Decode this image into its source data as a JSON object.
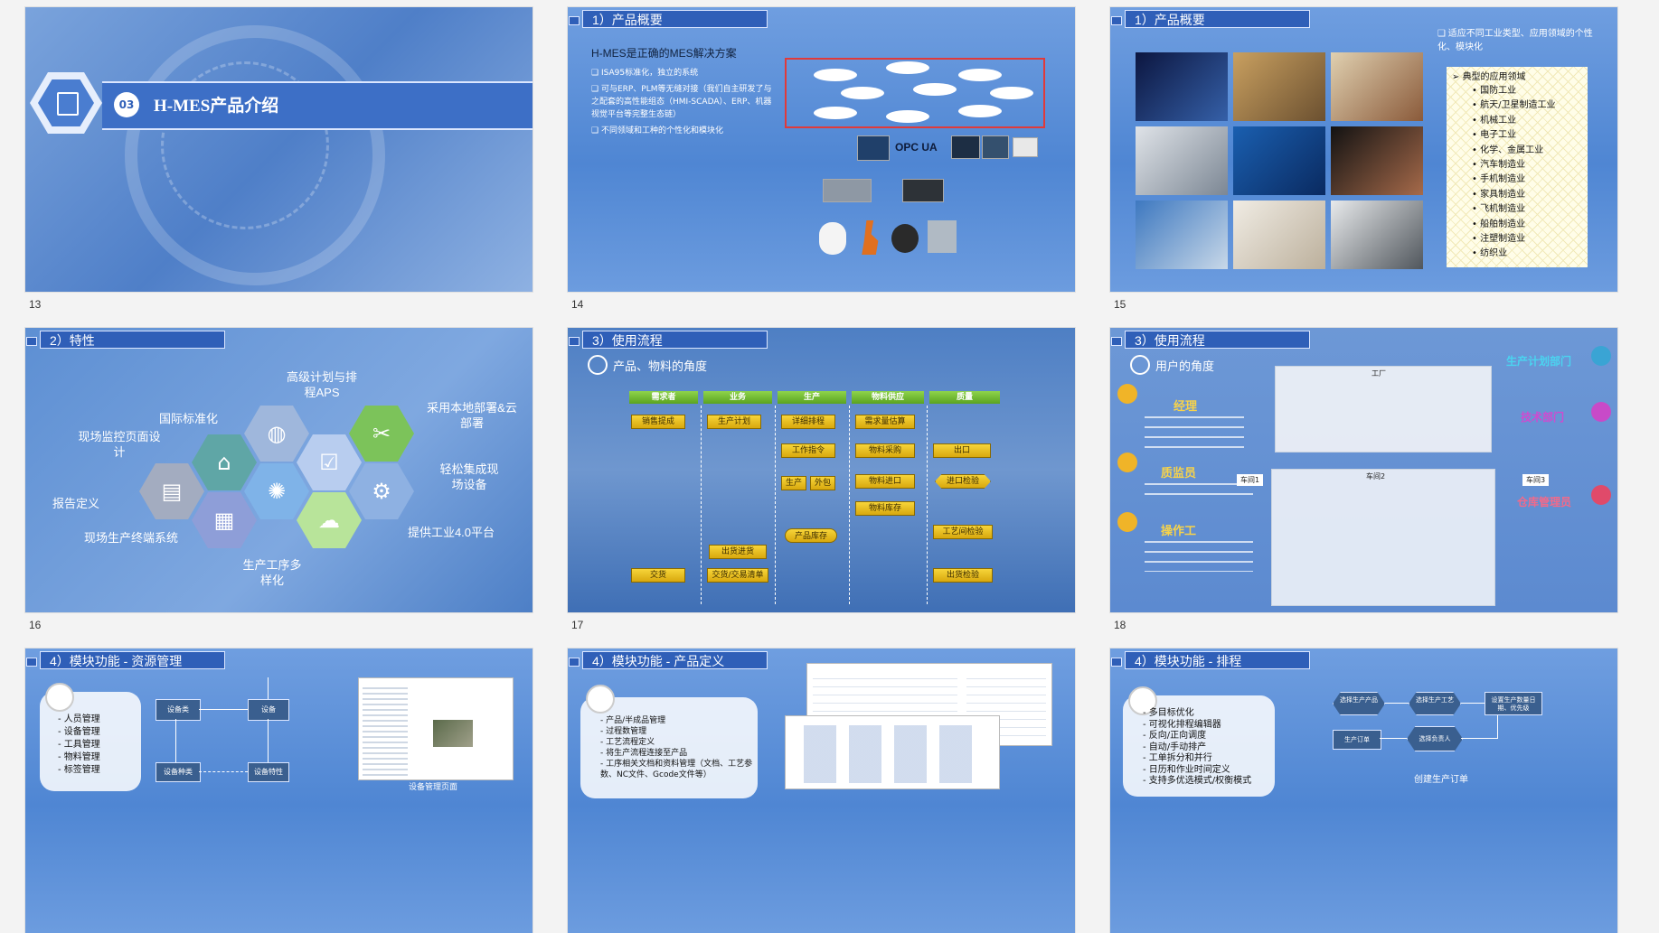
{
  "slides": [
    {
      "num": "13",
      "title": "H-MES产品介绍",
      "badge": "03"
    },
    {
      "num": "14",
      "title": "1）产品概要",
      "heading": "H-MES是正确的MES解决方案",
      "bullets": [
        "ISA95标准化，独立的系统",
        "可与ERP、PLM等无缝对接（我们自主研发了与之配套的高性能组态（HMI-SCADA）、ERP、机器视觉平台等完整生态链）",
        "不同领域和工种的个性化和模块化"
      ],
      "opc": "OPC UA"
    },
    {
      "num": "15",
      "title": "1）产品概要",
      "note": "适应不同工业类型、应用领域的个性化、模块化",
      "list_title": "典型的应用领域",
      "fields": [
        "国防工业",
        "航天/卫星制造工业",
        "机械工业",
        "电子工业",
        "化学、金属工业",
        "汽车制造业",
        "手机制造业",
        "家具制造业",
        "飞机制造业",
        "船舶制造业",
        "注塑制造业",
        "纺织业"
      ]
    },
    {
      "num": "16",
      "title": "2）特性",
      "features": {
        "f1": "高级计划与排程APS",
        "f2": "采用本地部署&云部署",
        "f3": "国际标准化",
        "f4": "现场监控页面设计",
        "f5": "轻松集成现场设备",
        "f6": "报告定义",
        "f7": "提供工业4.0平台",
        "f8": "现场生产终端系统",
        "f9": "生产工序多样化"
      }
    },
    {
      "num": "17",
      "title": "3）使用流程",
      "sub": "产品、物料的角度",
      "cols": [
        "需求者",
        "业务",
        "生产",
        "物料供应",
        "质量"
      ],
      "nodes": {
        "n1": "销售提成",
        "n2": "生产计划",
        "n3": "详细排程",
        "n4": "需求量估算",
        "n5": "工作指令",
        "n6": "物料采购",
        "n7": "出口",
        "n8": "生产",
        "n9": "外包",
        "n10": "物料进口",
        "n11": "进口检验",
        "n12": "物料库存",
        "n13": "产品库存",
        "n14": "工艺间检验",
        "n15": "出货进货",
        "n16": "交货",
        "n17": "交货/交易清单",
        "n18": "出货检验"
      }
    },
    {
      "num": "18",
      "title": "3）使用流程",
      "sub": "用户的角度",
      "roles": {
        "r1": "经理",
        "r2": "质监员",
        "r3": "操作工",
        "r4": "生产计划部门",
        "r5": "技术部门",
        "r6": "仓库管理员"
      },
      "factory": "工厂",
      "w1": "车间1",
      "w2": "车间2",
      "w3": "车间3"
    },
    {
      "num": "",
      "title": "4）模块功能 - 资源管理",
      "items": [
        "人员管理",
        "设备管理",
        "工具管理",
        "物料管理",
        "标签管理"
      ],
      "b1": "设备类",
      "b2": "设备",
      "b3": "设备种类",
      "b4": "设备特性",
      "caption": "设备管理页面"
    },
    {
      "num": "",
      "title": "4）模块功能 - 产品定义",
      "items": [
        "产品/半成品管理",
        "过程数管理",
        "工艺流程定义",
        "将生产流程连接至产品",
        "工序相关文档和资料管理（文档、工艺参数、NC文件、Gcode文件等）"
      ]
    },
    {
      "num": "",
      "title": "4）模块功能 - 排程",
      "items": [
        "多目标优化",
        "可视化排程编辑器",
        "反向/正向调度",
        "自动/手动排产",
        "工单拆分和并行",
        "日历和作业时间定义",
        "支持多优选模式/权衡模式"
      ],
      "d1": "选择生产产品",
      "d2": "选择生产工艺",
      "d3": "设置生产数量日期、优先级",
      "d4": "生产订单",
      "d5": "选择负责人",
      "d6": "创建生产订单"
    }
  ],
  "colors": {
    "title_bar": "#2f5fb8",
    "slide_bg": "#5a8fd8",
    "yellow": "#f0c72c",
    "green": "#7ac13a"
  }
}
